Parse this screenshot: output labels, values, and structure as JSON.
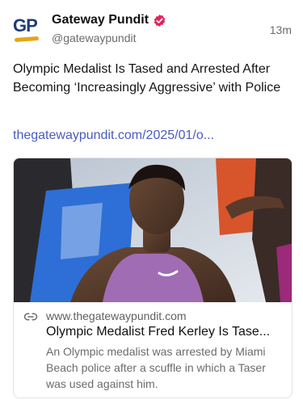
{
  "author": {
    "avatar_text": "GP",
    "display_name": "Gateway Pundit",
    "handle": "@gatewaypundit",
    "verified_icon": "verified-badge-icon",
    "brand_color": "#1f3d7a",
    "verified_color": "#e0245e"
  },
  "post": {
    "time": "13m",
    "text": "Olympic Medalist Is Tased and Arrested After Becoming ‘Increasingly Aggressive’ with Police",
    "link": "thegatewaypundit.com/2025/01/o..."
  },
  "card": {
    "link_icon": "link-icon",
    "domain": "www.thegatewaypundit.com",
    "title": "Olympic Medalist Fred Kerley Is Tase...",
    "description": "An Olympic medalist was arrested by Miami Beach police after a scuffle in which a Taser was used against him."
  }
}
